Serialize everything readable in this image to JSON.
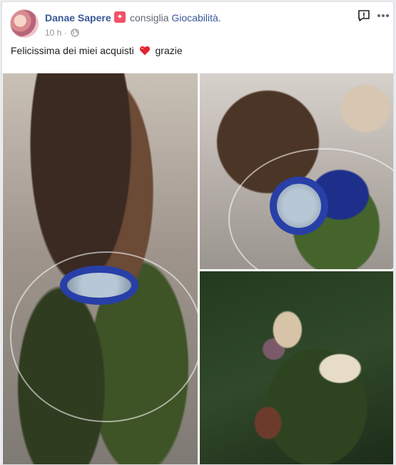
{
  "post": {
    "author": "Danae Sapere",
    "action": "consiglia",
    "page": "Giocabilità",
    "page_suffix": ".",
    "time": "10 h",
    "separator": "·",
    "text_before": "Felicissima dei miei acquisti",
    "text_after": "grazie"
  },
  "icons": {
    "avatar": "profile-picture",
    "badge": "recommendation-badge-icon",
    "privacy": "globe-icon",
    "report": "report-icon",
    "more": "more-options-icon",
    "heart": "heart-emoji"
  },
  "colors": {
    "link": "#385898",
    "badge": "#f25268",
    "heart": "#e0252f",
    "muted": "#90949c"
  },
  "photos": [
    {
      "subject": "child with magnifier over glass bowl"
    },
    {
      "subject": "child with blue magnifier at terrarium"
    },
    {
      "subject": "snails on spinach leaves"
    }
  ]
}
